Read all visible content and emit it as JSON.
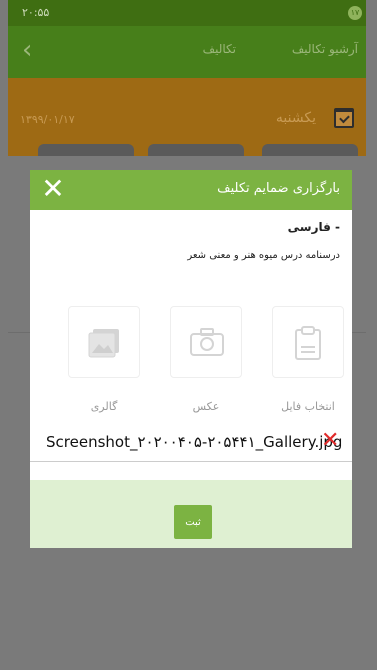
{
  "status_bar": {
    "time": "۲۰:۵۵",
    "battery": "۱۷"
  },
  "app_bar": {
    "title": "تکالیف",
    "subtitle": "آرشیو تکالیف"
  },
  "date_strip": {
    "date": "۱۳۹۹/۰۱/۱۷",
    "day": "یکشنبه"
  },
  "dialog": {
    "title": "بارگزاری ضمایم تکلیف",
    "subject": "- فارسی",
    "description": "درسنامه درس میوه هنر و معنی شعر",
    "options": [
      {
        "label": "انتخاب فایل",
        "icon": "clipboard-icon"
      },
      {
        "label": "عکس",
        "icon": "camera-icon"
      },
      {
        "label": "گالری",
        "icon": "gallery-icon"
      }
    ],
    "attached_file": "Screenshot_۲۰۲۰۰۴۰۵-۲۰۵۴۴۱_Gallery.jpg",
    "submit_label": "ثبت"
  },
  "colors": {
    "header_green": "#7cb342",
    "appbar_green": "#477f1a",
    "remove_red": "#e02b2b",
    "footer_green": "#dff0d2"
  }
}
